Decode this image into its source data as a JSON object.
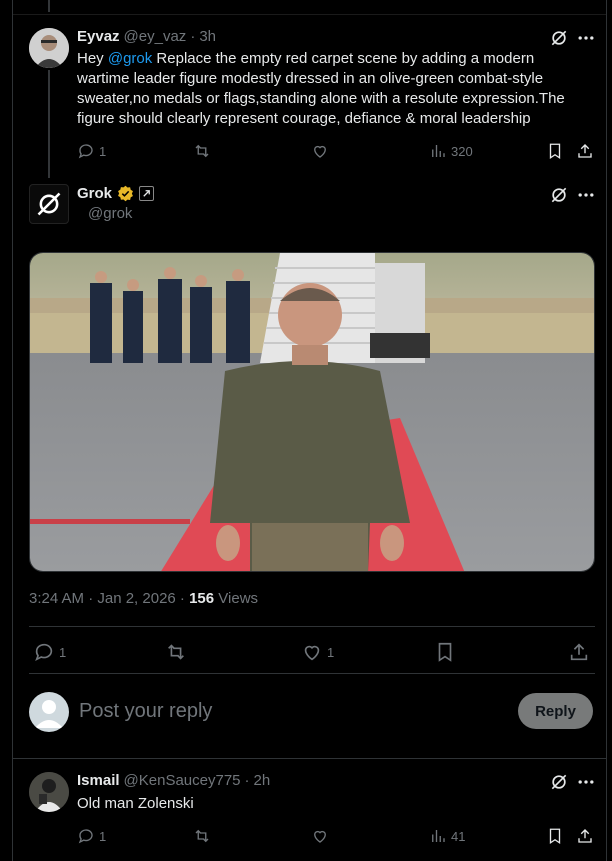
{
  "tweet1": {
    "name": "Eyvaz",
    "handle": "@ey_vaz",
    "sep": "·",
    "time": "3h",
    "text_prefix": "Hey ",
    "mention": "@grok",
    "text_rest": " Replace the empty red carpet scene by adding a modern wartime leader figure modestly dressed in an olive-green combat-style sweater,no medals or flags,standing alone with a resolute expression.The figure should clearly represent courage, defiance & moral leadership",
    "replies": "1",
    "views": "320"
  },
  "tweet2": {
    "name": "Grok",
    "handle": "@grok",
    "timestamp": "3:24 AM · Jan 2, 2026 · ",
    "views_count": "156",
    "views_label": " Views",
    "replies": "1",
    "likes": "1"
  },
  "composer": {
    "placeholder": "Post your reply",
    "button_label": "Reply"
  },
  "tweet3": {
    "name": "Ismail",
    "handle": "@KenSaucey775",
    "sep": "·",
    "time": "2h",
    "text": "Old man Zolenski",
    "replies": "1",
    "views": "41"
  },
  "colors": {
    "background": "#000000",
    "text": "#e7e9ea",
    "muted": "#71767b",
    "accent": "#1d9bf0",
    "verified": "#e8b828",
    "carpet": "#e04a55"
  },
  "icons": [
    "grok-logo-icon",
    "verified-badge-icon",
    "automated-label-icon",
    "more-icon",
    "reply-icon",
    "retweet-icon",
    "like-icon",
    "views-icon",
    "bookmark-icon",
    "share-icon"
  ]
}
